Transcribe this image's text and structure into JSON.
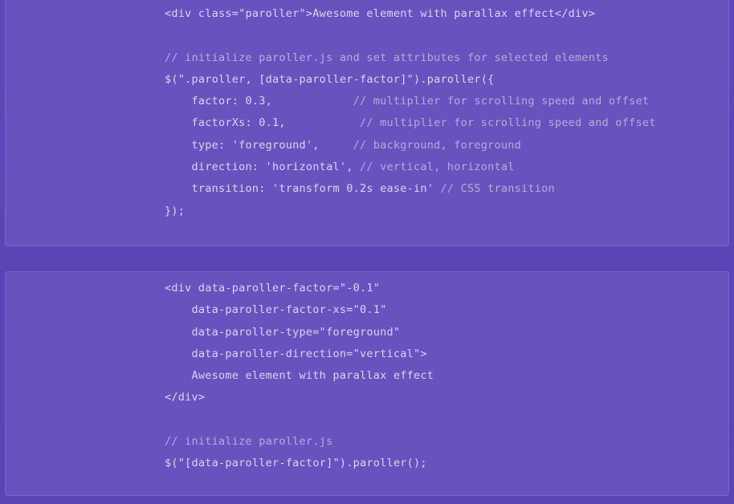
{
  "page": {
    "background_color": "#5d45b7",
    "block_background_color": "#6a52be",
    "block_border_color": "#7a63c9",
    "code_text_color": "#d9d4f0",
    "comment_text_color": "#b4abdd"
  },
  "blocks": [
    {
      "name": "paroller-js-init-example",
      "lines": [
        {
          "code": "<div class=\"paroller\">Awesome element with parallax effect</div>",
          "comment": ""
        },
        {
          "code": "",
          "comment": ""
        },
        {
          "code": "",
          "comment": "// initialize paroller.js and set attributes for selected elements"
        },
        {
          "code": "$(\".paroller, [data-paroller-factor]\").paroller({",
          "comment": ""
        },
        {
          "code": "    factor: 0.3,            ",
          "comment": "// multiplier for scrolling speed and offset"
        },
        {
          "code": "    factorXs: 0.1,           ",
          "comment": "// multiplier for scrolling speed and offset"
        },
        {
          "code": "    type: 'foreground',     ",
          "comment": "// background, foreground"
        },
        {
          "code": "    direction: 'horizontal', ",
          "comment": "// vertical, horizontal"
        },
        {
          "code": "    transition: 'transform 0.2s ease-in' ",
          "comment": "// CSS transition"
        },
        {
          "code": "});",
          "comment": ""
        }
      ]
    },
    {
      "name": "paroller-data-attributes-example",
      "lines": [
        {
          "code": "<div data-paroller-factor=\"-0.1\"",
          "comment": ""
        },
        {
          "code": "    data-paroller-factor-xs=\"0.1\"",
          "comment": ""
        },
        {
          "code": "    data-paroller-type=\"foreground\"",
          "comment": ""
        },
        {
          "code": "    data-paroller-direction=\"vertical\">",
          "comment": ""
        },
        {
          "code": "    Awesome element with parallax effect",
          "comment": ""
        },
        {
          "code": "</div>",
          "comment": ""
        },
        {
          "code": "",
          "comment": ""
        },
        {
          "code": "",
          "comment": "// initialize paroller.js"
        },
        {
          "code": "$(\"[data-paroller-factor]\").paroller();",
          "comment": ""
        }
      ]
    }
  ]
}
